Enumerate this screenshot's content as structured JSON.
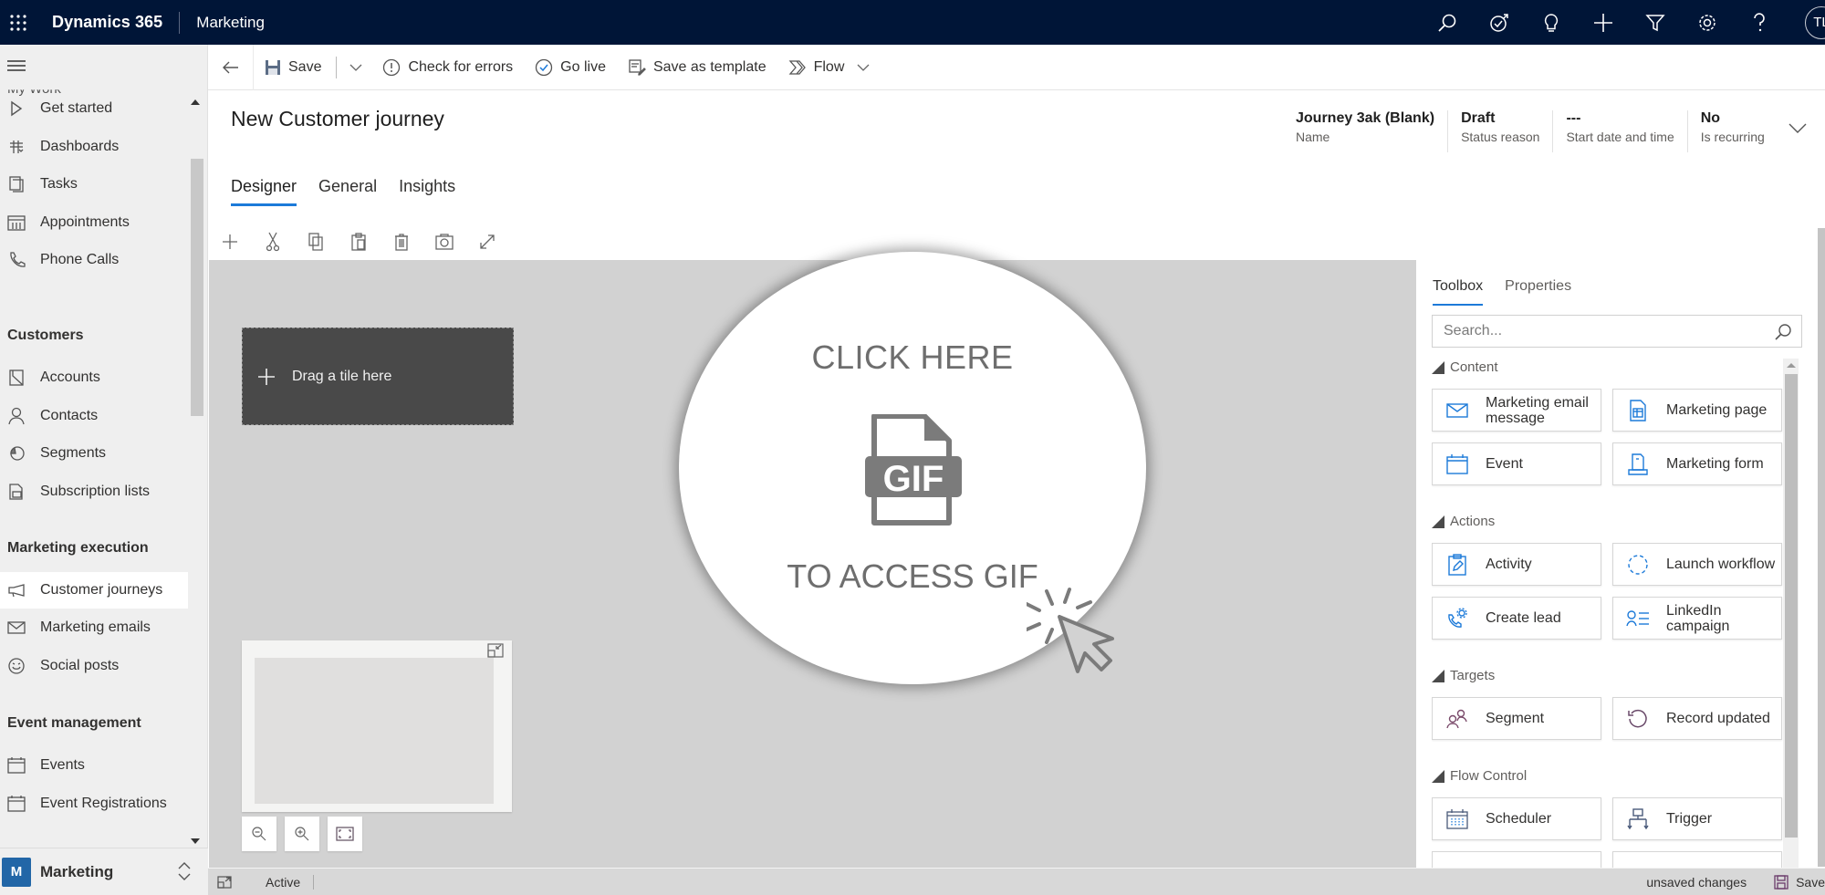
{
  "topbar": {
    "brand": "Dynamics 365",
    "app_name": "Marketing",
    "icons": [
      "search-icon",
      "task-flow-icon",
      "lightbulb-icon",
      "plus-icon",
      "filter-icon",
      "settings-icon",
      "help-icon"
    ],
    "user_initials": "TL"
  },
  "sidebar": {
    "cut_group": "My Work",
    "items_mywork": [
      {
        "label": "Get started",
        "icon": "play-icon"
      },
      {
        "label": "Dashboards",
        "icon": "dashboard-icon"
      },
      {
        "label": "Tasks",
        "icon": "tasks-icon"
      },
      {
        "label": "Appointments",
        "icon": "calendar-icon"
      },
      {
        "label": "Phone Calls",
        "icon": "phone-icon"
      }
    ],
    "group_customers": "Customers",
    "items_customers": [
      {
        "label": "Accounts",
        "icon": "account-icon"
      },
      {
        "label": "Contacts",
        "icon": "contact-icon"
      },
      {
        "label": "Segments",
        "icon": "segment-icon"
      },
      {
        "label": "Subscription lists",
        "icon": "subscription-icon"
      }
    ],
    "group_execution": "Marketing execution",
    "items_execution": [
      {
        "label": "Customer journeys",
        "icon": "megaphone-icon",
        "active": true
      },
      {
        "label": "Marketing emails",
        "icon": "mail-icon"
      },
      {
        "label": "Social posts",
        "icon": "social-icon"
      }
    ],
    "group_events": "Event management",
    "items_events": [
      {
        "label": "Events",
        "icon": "event-icon"
      },
      {
        "label": "Event Registrations",
        "icon": "event-icon"
      }
    ],
    "area": {
      "badge": "M",
      "name": "Marketing"
    }
  },
  "commandbar": {
    "save": "Save",
    "check_errors": "Check for errors",
    "go_live": "Go live",
    "save_template": "Save as template",
    "flow": "Flow"
  },
  "header": {
    "title": "New Customer journey",
    "fields": [
      {
        "value": "Journey 3ak (Blank)",
        "label": "Name"
      },
      {
        "value": "Draft",
        "label": "Status reason"
      },
      {
        "value": "---",
        "label": "Start date and time"
      },
      {
        "value": "No",
        "label": "Is recurring"
      }
    ]
  },
  "tabs": [
    {
      "label": "Designer",
      "active": true
    },
    {
      "label": "General",
      "active": false
    },
    {
      "label": "Insights",
      "active": false
    }
  ],
  "designer_tools": [
    "add-icon",
    "cut-icon",
    "copy-icon",
    "paste-icon",
    "delete-icon",
    "screenshot-icon",
    "expand-icon"
  ],
  "canvas": {
    "drag_tile": "Drag a tile here"
  },
  "overlay": {
    "top_text": "CLICK HERE",
    "icon_text": "GIF",
    "bottom_text": "TO ACCESS GIF"
  },
  "toolbox": {
    "tabs": [
      {
        "label": "Toolbox",
        "active": true
      },
      {
        "label": "Properties",
        "active": false
      }
    ],
    "search_placeholder": "Search...",
    "groups": [
      {
        "name": "Content",
        "tiles": [
          {
            "label": "Marketing email message",
            "icon": "mail-icon"
          },
          {
            "label": "Marketing page",
            "icon": "page-icon"
          },
          {
            "label": "Event",
            "icon": "event-icon"
          },
          {
            "label": "Marketing form",
            "icon": "form-icon"
          }
        ]
      },
      {
        "name": "Actions",
        "tiles": [
          {
            "label": "Activity",
            "icon": "activity-icon"
          },
          {
            "label": "Launch workflow",
            "icon": "workflow-icon"
          },
          {
            "label": "Create lead",
            "icon": "lead-icon"
          },
          {
            "label": "LinkedIn campaign",
            "icon": "linkedin-campaign-icon"
          }
        ]
      },
      {
        "name": "Targets",
        "tiles": [
          {
            "label": "Segment",
            "icon": "segment-icon"
          },
          {
            "label": "Record updated",
            "icon": "record-updated-icon"
          }
        ]
      },
      {
        "name": "Flow Control",
        "tiles": [
          {
            "label": "Scheduler",
            "icon": "scheduler-icon"
          },
          {
            "label": "Trigger",
            "icon": "trigger-icon"
          }
        ]
      }
    ]
  },
  "statusbar": {
    "status": "Active",
    "unsaved": "unsaved changes",
    "save": "Save"
  },
  "colors": {
    "topbar": "#001537",
    "accent": "#1c7ad9",
    "area_badge": "#2266a7",
    "canvas": "#d2d2d2",
    "drag_tile": "#494949"
  }
}
